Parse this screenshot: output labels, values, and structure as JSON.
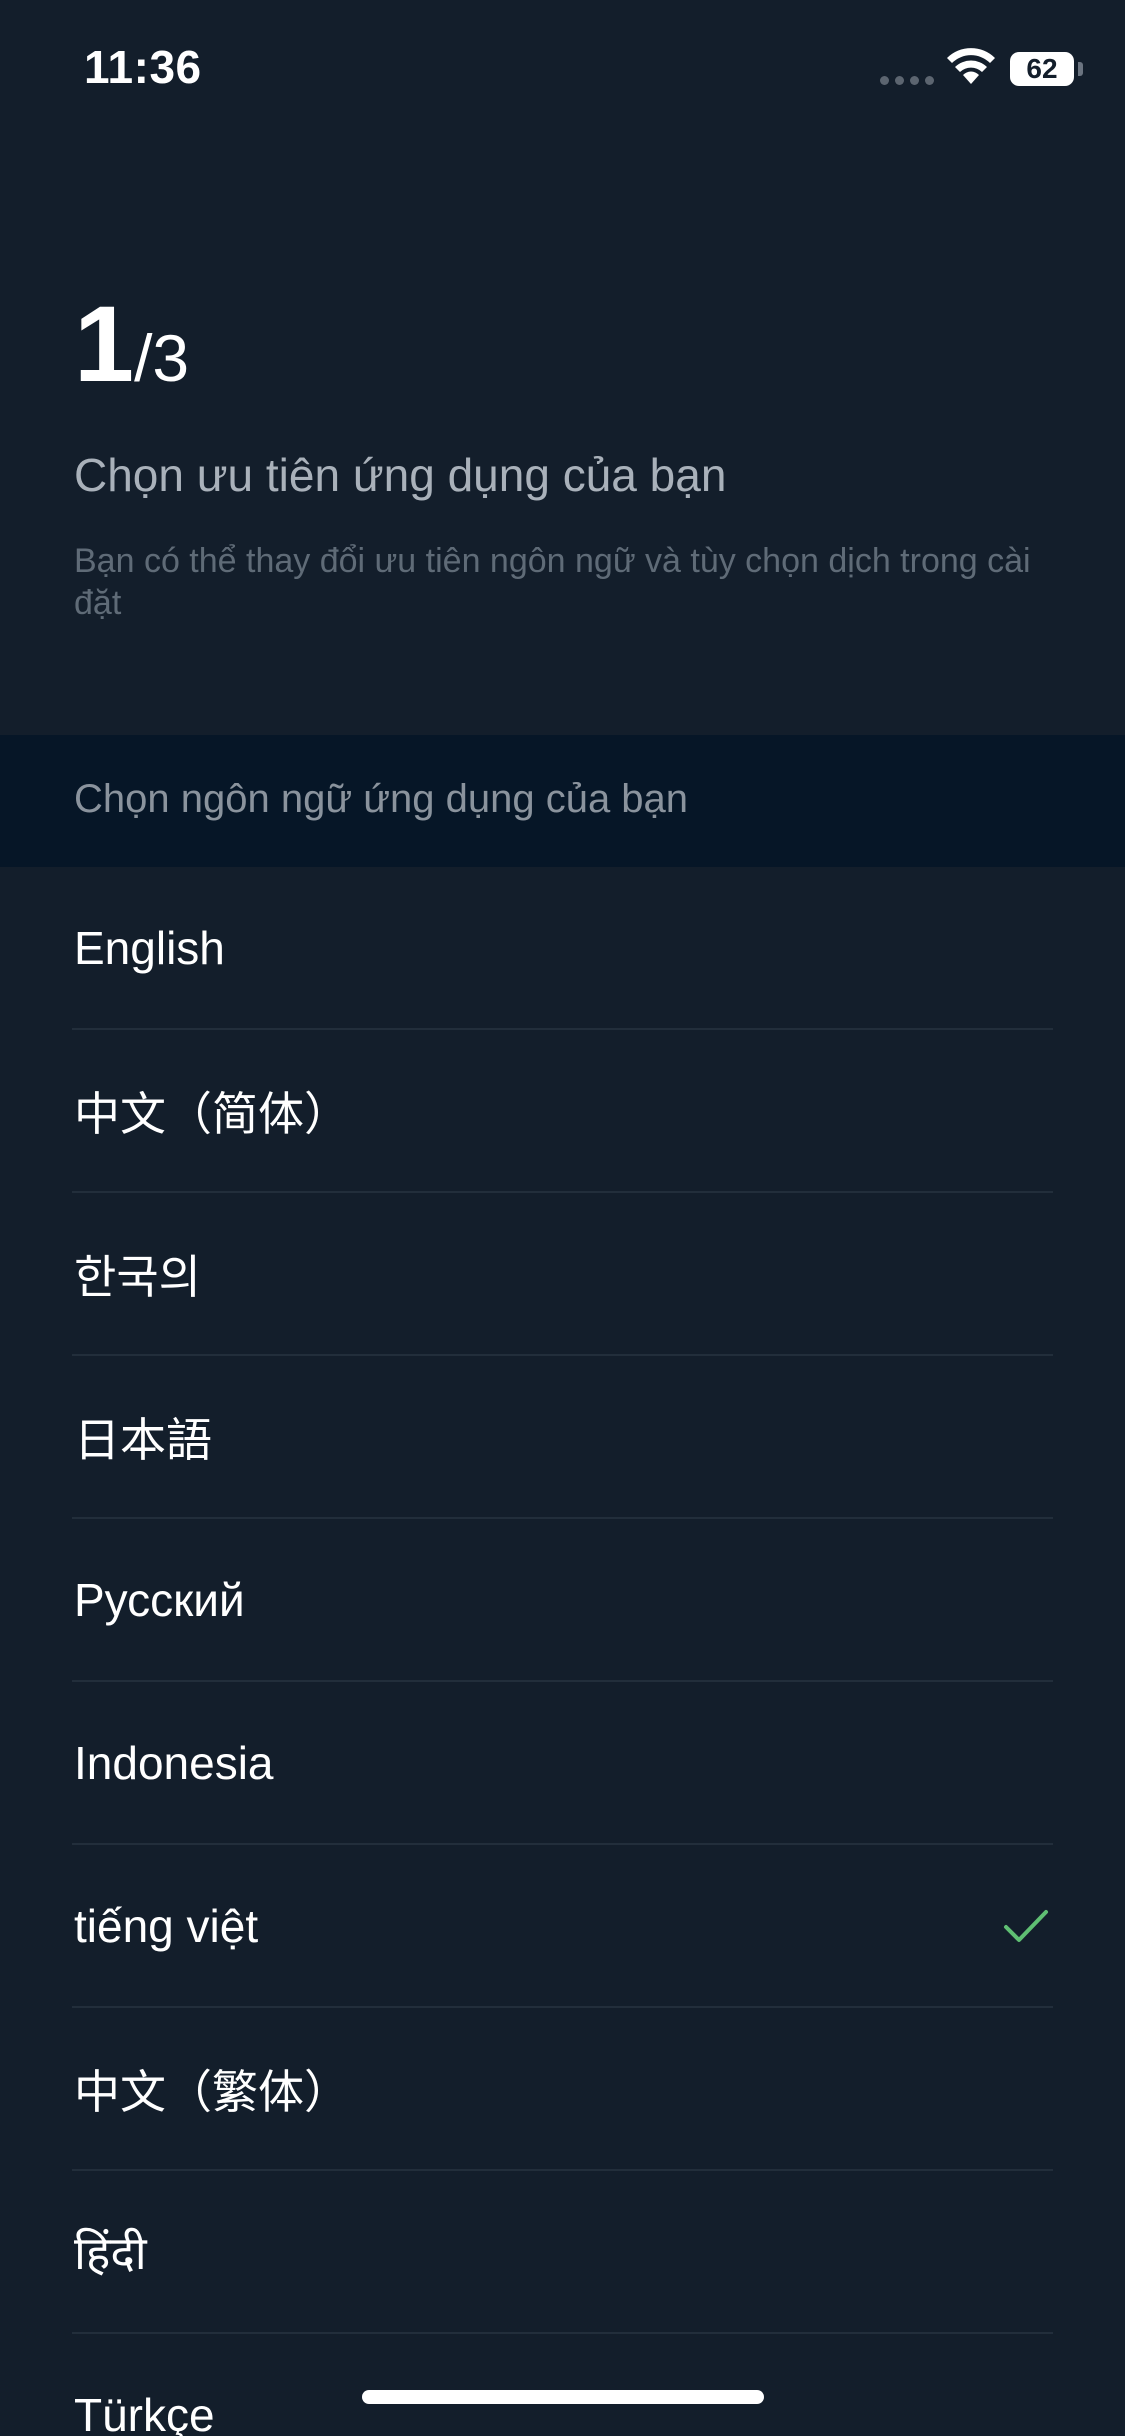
{
  "status_bar": {
    "time": "11:36",
    "battery": "62"
  },
  "header": {
    "step_current": "1",
    "step_total": "/3",
    "title": "Chọn ưu tiên ứng dụng của bạn",
    "subtitle": "Bạn có thể thay đổi ưu tiên ngôn ngữ và tùy chọn dịch trong cài đặt"
  },
  "section": {
    "label": "Chọn ngôn ngữ ứng dụng của bạn"
  },
  "languages": [
    {
      "label": "English",
      "selected": false
    },
    {
      "label": "中文（简体）",
      "selected": false
    },
    {
      "label": "한국의",
      "selected": false
    },
    {
      "label": "日本語",
      "selected": false
    },
    {
      "label": "Русский",
      "selected": false
    },
    {
      "label": "Indonesia",
      "selected": false
    },
    {
      "label": "tiếng việt",
      "selected": true
    },
    {
      "label": "中文（繁体）",
      "selected": false
    },
    {
      "label": "हिंदी",
      "selected": false
    },
    {
      "label": "Türkçe",
      "selected": false
    }
  ],
  "colors": {
    "background": "#131e2b",
    "section_background": "#061627",
    "check": "#5fbf73",
    "divider": "#222e3b"
  },
  "icons": {
    "selected_marker": "check-icon",
    "wifi": "wifi-icon"
  }
}
